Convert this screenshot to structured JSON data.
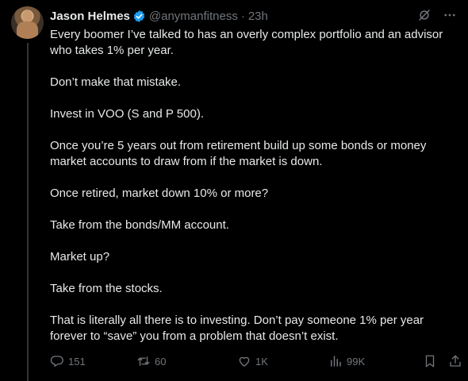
{
  "author": {
    "name": "Jason Helmes",
    "handle": "@anymanfitness",
    "separator": "·",
    "time": "23h"
  },
  "post": {
    "paragraphs": [
      "Every boomer I’ve talked to has an overly complex portfolio and an advisor who takes 1% per year.",
      "Don’t make that mistake.",
      "Invest in VOO (S and P 500).",
      "Once you’re 5 years out from retirement build up some bonds or money market accounts to draw from if the market is down.",
      "Once retired, market down 10% or more?",
      "Take from the bonds/MM account.",
      "Market up?",
      "Take from the stocks.",
      "That is literally all there is to investing. Don’t pay someone 1% per year forever to “save” you from a problem that doesn’t exist."
    ]
  },
  "actions": {
    "replies": "151",
    "reposts": "60",
    "likes": "1K",
    "views": "99K"
  },
  "icons": {
    "verified": "verified-badge-icon",
    "grok": "grok-icon",
    "more": "more-icon",
    "reply": "reply-icon",
    "repost": "repost-icon",
    "like": "like-icon",
    "views": "views-icon",
    "bookmark": "bookmark-icon",
    "share": "share-icon"
  },
  "colors": {
    "background": "#000000",
    "text": "#e7e9ea",
    "muted": "#71767b",
    "verified": "#1d9bf0"
  }
}
